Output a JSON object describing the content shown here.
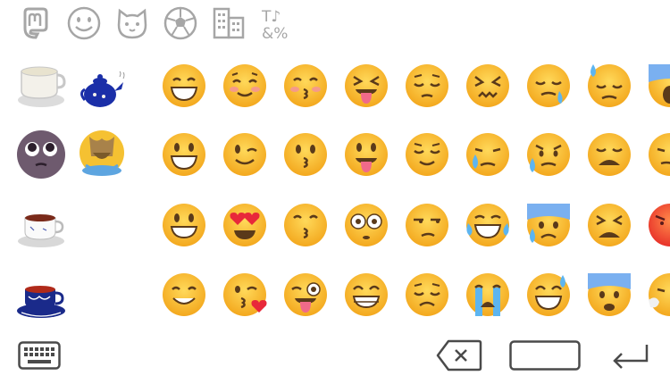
{
  "tabs": [
    {
      "name": "mastodon-icon"
    },
    {
      "name": "smiley-icon"
    },
    {
      "name": "cat-face-icon"
    },
    {
      "name": "soccer-ball-icon"
    },
    {
      "name": "building-icon"
    },
    {
      "name": "symbols-icon",
      "label_top": "T♪",
      "label_bottom": "&%"
    }
  ],
  "custom_emoji": [
    "white-tea-cup-emoji",
    "blue-teapot-emoji",
    "pleading-face-emoji",
    "crying-cat-emoji",
    "red-tea-cup-emoji",
    "blue-porcelain-cup-emoji"
  ],
  "standard_emoji": [
    [
      "grinning-squint-eyes",
      "smiling-blush",
      "kissing-smiling-eyes",
      "squinting-tongue",
      "pensive",
      "confounded",
      "sleepy",
      "downcast-sweat",
      "screaming"
    ],
    [
      "smiley",
      "wink",
      "kissing",
      "tongue-out",
      "relieved",
      "crying",
      "disappointed-relieved",
      "weary",
      "unamused-partial"
    ],
    [
      "grinning",
      "heart-eyes",
      "kissing-closed-eyes",
      "flushed",
      "unamused",
      "joy",
      "cold-sweat",
      "tired",
      "angry"
    ],
    [
      "smiling",
      "blowing-kiss",
      "winking-tongue",
      "beaming",
      "disappointed",
      "loudly-crying",
      "grinning-sweat",
      "fearful",
      "cold-face-partial"
    ]
  ],
  "colors": {
    "icon_gray": "#a6a6a6",
    "dark_gray": "#4a4a4a",
    "emoji_yellow": "#f8c23c"
  }
}
